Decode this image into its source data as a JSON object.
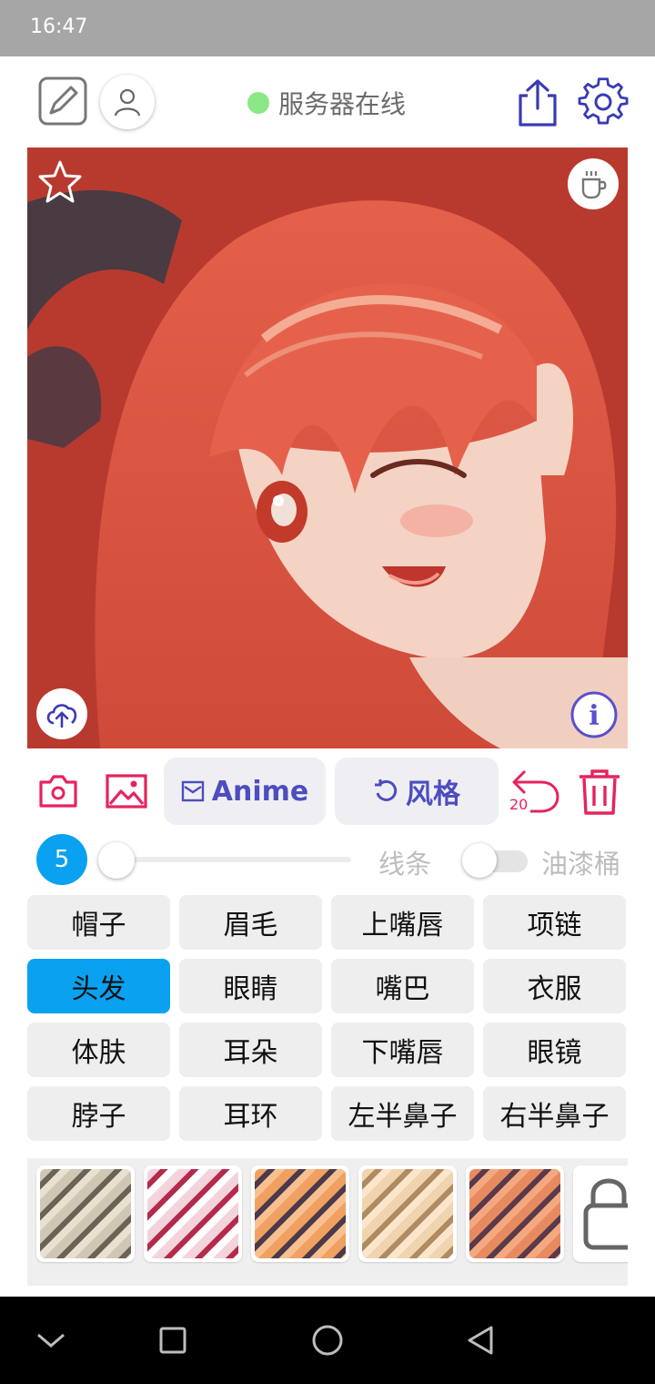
{
  "status_bar": {
    "time": "16:47"
  },
  "header": {
    "server_status": "服务器在线",
    "status_color": "#8ae886",
    "icons": [
      "edit-icon",
      "user-icon",
      "share-icon",
      "settings-icon"
    ]
  },
  "canvas": {
    "icons": [
      "star-icon",
      "coffee-icon",
      "upload-cloud-icon",
      "info-icon"
    ]
  },
  "toolbar": {
    "anime_label": "Anime",
    "style_label": "风格",
    "undo_count": "20",
    "icons": [
      "camera-icon",
      "image-icon",
      "trash-icon"
    ],
    "accent_color": "#e6235e",
    "button_text_color": "#4d4dc0"
  },
  "brush": {
    "size": "5",
    "line_label": "线条",
    "paint_bucket_label": "油漆桶",
    "paint_bucket_on": false
  },
  "parts": [
    {
      "label": "帽子",
      "active": false
    },
    {
      "label": "眉毛",
      "active": false
    },
    {
      "label": "上嘴唇",
      "active": false
    },
    {
      "label": "项链",
      "active": false
    },
    {
      "label": "头发",
      "active": true
    },
    {
      "label": "眼睛",
      "active": false
    },
    {
      "label": "嘴巴",
      "active": false
    },
    {
      "label": "衣服",
      "active": false
    },
    {
      "label": "体肤",
      "active": false
    },
    {
      "label": "耳朵",
      "active": false
    },
    {
      "label": "下嘴唇",
      "active": false
    },
    {
      "label": "眼镜",
      "active": false
    },
    {
      "label": "脖子",
      "active": false
    },
    {
      "label": "耳环",
      "active": false
    },
    {
      "label": "左半鼻子",
      "active": false
    },
    {
      "label": "右半鼻子",
      "active": false
    }
  ],
  "active_color": "#0aa2f0",
  "swatch_colors": [
    "#b8b0a2",
    "#c23c5c",
    "#e08a4a",
    "#e8c49a",
    "#e07a55"
  ],
  "nav_icons": [
    "chevron-down-icon",
    "recent-apps-icon",
    "home-icon",
    "back-icon"
  ]
}
